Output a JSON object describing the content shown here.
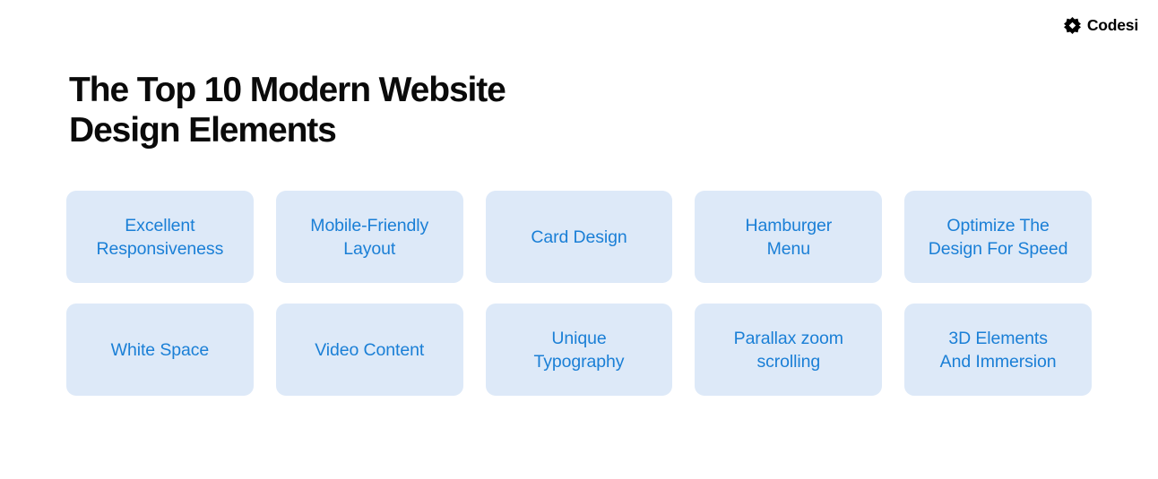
{
  "brand": {
    "name": "Codesi",
    "mark_icon": "star-diamond-logo-icon",
    "mark_color": "#000000"
  },
  "heading": {
    "title": "The Top 10 Modern Website\nDesign Elements",
    "color": "#0a0a0a"
  },
  "theme": {
    "background": "#ffffff",
    "card_background": "#dde9f8",
    "card_text": "#1a7fd6"
  },
  "cards": [
    {
      "label": "Excellent\nResponsiveness"
    },
    {
      "label": "Mobile-Friendly\nLayout"
    },
    {
      "label": "Card Design"
    },
    {
      "label": "Hamburger\nMenu"
    },
    {
      "label": "Optimize The\nDesign For Speed"
    },
    {
      "label": "White Space"
    },
    {
      "label": "Video Content"
    },
    {
      "label": "Unique\nTypography"
    },
    {
      "label": "Parallax zoom\nscrolling"
    },
    {
      "label": "3D Elements\nAnd Immersion"
    }
  ]
}
